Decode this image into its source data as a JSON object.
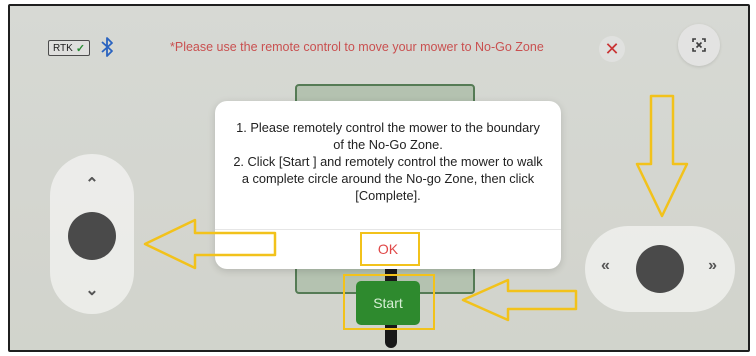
{
  "status": {
    "rtk_label": "RTK",
    "rtk_check_icon": "check-icon",
    "bluetooth_icon": "bluetooth-icon"
  },
  "notice": "*Please use the remote control to move your mower to No-Go Zone",
  "header": {
    "close_icon": "close-icon",
    "close_symbol": "✕",
    "exit_icon": "exit-fullscreen-icon"
  },
  "dialog": {
    "line1": "1. Please remotely control the mower to the boundary of the No-Go Zone.",
    "line2": "2. Click [Start ] and remotely control the mower to walk a complete circle around the No-go Zone, then click [Complete].",
    "ok_label": "OK"
  },
  "controls": {
    "left_up": "⌃",
    "left_down": "⌄",
    "right_left": "«",
    "right_right": "»"
  },
  "start_label": "Start",
  "colors": {
    "accent_green": "#2e8a2e",
    "notice_red": "#e05a5a",
    "highlight_yellow": "#f2c21b"
  }
}
